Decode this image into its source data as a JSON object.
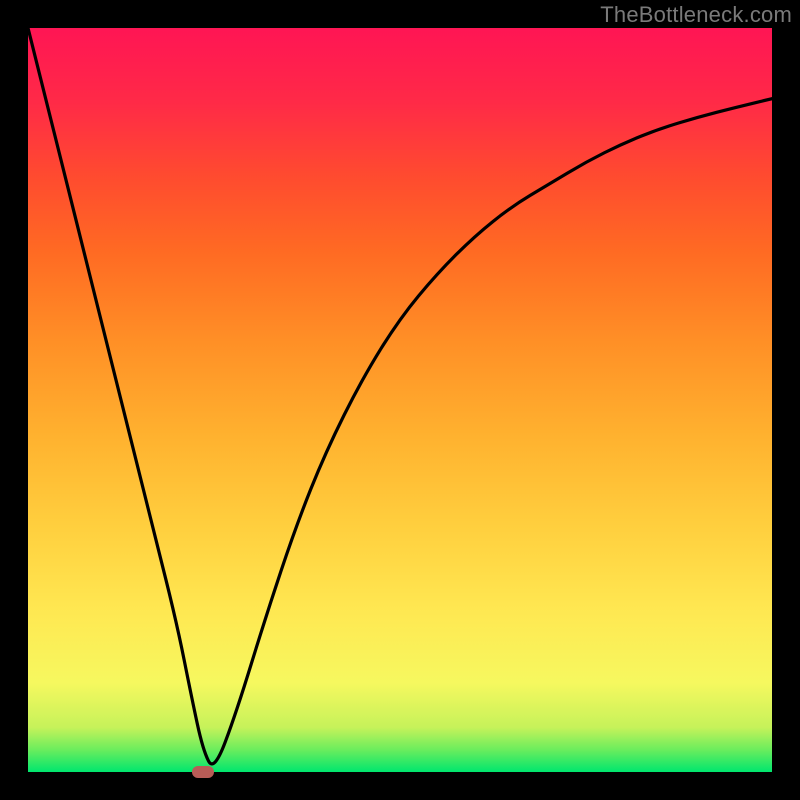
{
  "watermark": "TheBottleneck.com",
  "chart_data": {
    "type": "line",
    "title": "",
    "xlabel": "",
    "ylabel": "",
    "xlim": [
      0,
      100
    ],
    "ylim": [
      0,
      100
    ],
    "grid": false,
    "legend": false,
    "background_gradient": {
      "direction": "bottom-to-top",
      "stops": [
        {
          "pos": 0,
          "color": "#00e66e"
        },
        {
          "pos": 0.06,
          "color": "#c6f25a"
        },
        {
          "pos": 0.12,
          "color": "#f6f85f"
        },
        {
          "pos": 0.33,
          "color": "#ffcf3e"
        },
        {
          "pos": 0.58,
          "color": "#ff8f26"
        },
        {
          "pos": 0.8,
          "color": "#ff4b2f"
        },
        {
          "pos": 1.0,
          "color": "#ff1554"
        }
      ]
    },
    "series": [
      {
        "name": "bottleneck-curve",
        "x": [
          0,
          2,
          5,
          8,
          11,
          14,
          17,
          20,
          22,
          23.5,
          25,
          28,
          32,
          36,
          40,
          45,
          50,
          55,
          60,
          65,
          70,
          75,
          80,
          85,
          90,
          95,
          100
        ],
        "values": [
          100,
          92,
          80,
          68,
          56,
          44,
          32,
          20,
          10,
          3,
          0,
          8,
          21,
          33,
          43,
          53,
          61,
          67,
          72,
          76,
          79,
          82,
          84.5,
          86.5,
          88,
          89.3,
          90.5
        ]
      }
    ],
    "marker": {
      "x": 23.5,
      "y": 0,
      "shape": "rounded-rect",
      "color": "#b85c57"
    }
  }
}
